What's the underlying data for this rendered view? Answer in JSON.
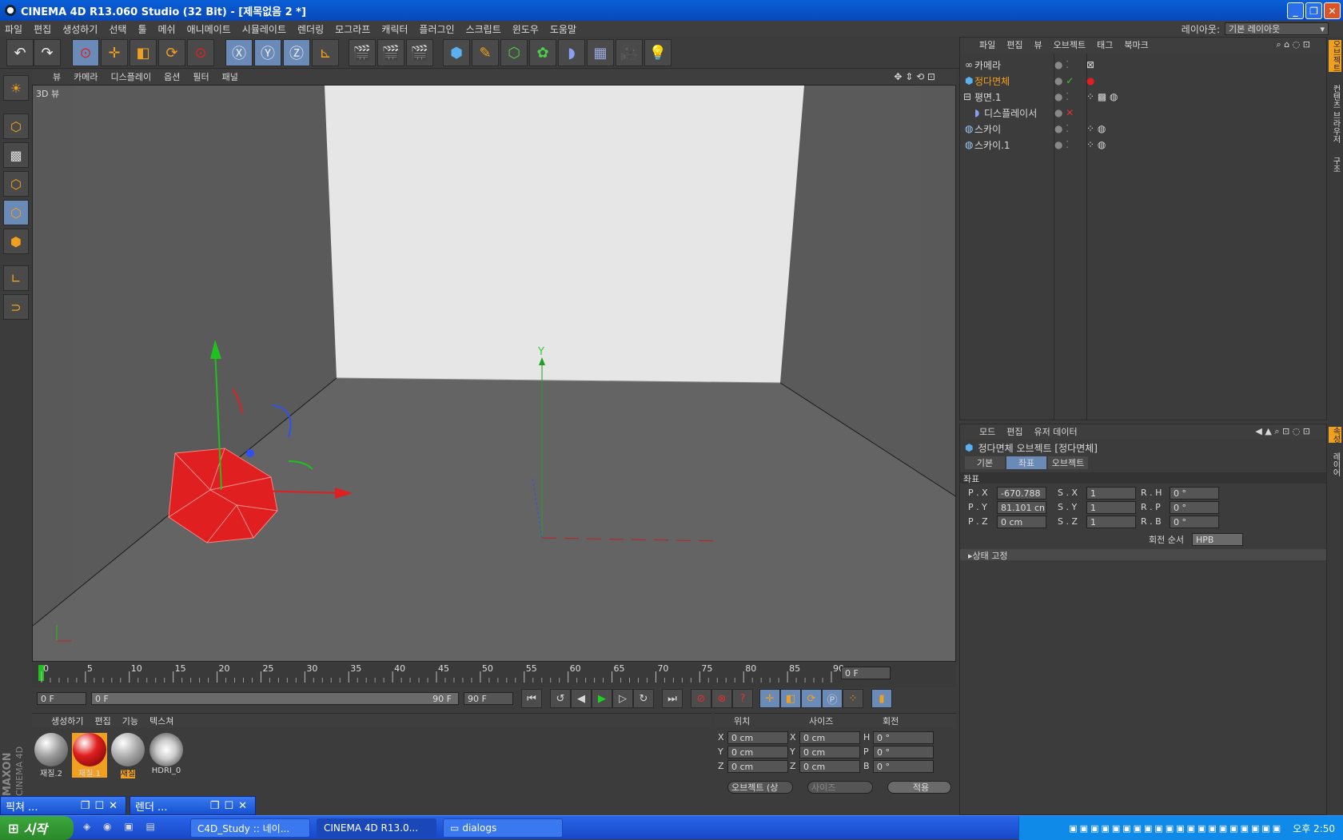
{
  "window": {
    "title": "CINEMA 4D R13.060 Studio (32 Bit) - [제목없음 2 *]",
    "min": "_",
    "max": "❐",
    "close": "✕"
  },
  "menu": [
    "파일",
    "편집",
    "생성하기",
    "선택",
    "툴",
    "메쉬",
    "애니메이트",
    "시뮬레이트",
    "렌더링",
    "모그라프",
    "캐릭터",
    "플러그인",
    "스크립트",
    "윈도우",
    "도움말"
  ],
  "layout": {
    "label": "레이아웃:",
    "value": "기본 레이아웃"
  },
  "viewport": {
    "menu": [
      "뷰",
      "카메라",
      "디스플레이",
      "옵션",
      "필터",
      "패널"
    ],
    "label": "3D 뷰",
    "axis_y": "Y"
  },
  "timeline": {
    "ticks": [
      "0",
      "5",
      "10",
      "15",
      "20",
      "25",
      "30",
      "35",
      "40",
      "45",
      "50",
      "55",
      "60",
      "65",
      "70",
      "75",
      "80",
      "85",
      "90"
    ],
    "current": "0 F"
  },
  "transport": {
    "start": "0 F",
    "range_start": "0 F",
    "range_end": "90 F",
    "end": "90 F"
  },
  "materials": {
    "menu": [
      "생성하기",
      "편집",
      "기능",
      "텍스쳐"
    ],
    "items": [
      "재질.2",
      "재질.1",
      "재질",
      "HDRI_0"
    ]
  },
  "coords": {
    "headers": [
      "위치",
      "사이즈",
      "회전"
    ],
    "rows": [
      [
        "X",
        "0 cm",
        "X",
        "0 cm",
        "H",
        "0 °"
      ],
      [
        "Y",
        "0 cm",
        "Y",
        "0 cm",
        "P",
        "0 °"
      ],
      [
        "Z",
        "0 cm",
        "Z",
        "0 cm",
        "B",
        "0 °"
      ]
    ],
    "mode": "오브젝트 (상",
    "size_mode": "사이즈",
    "apply": "적용"
  },
  "object_manager": {
    "menu": [
      "파일",
      "편집",
      "뷰",
      "오브젝트",
      "태그",
      "북마크"
    ],
    "objects": [
      {
        "name": "카메라"
      },
      {
        "name": "정다면체"
      },
      {
        "name": "평면.1"
      },
      {
        "name": "디스플레이서"
      },
      {
        "name": "스카이"
      },
      {
        "name": "스카이.1"
      }
    ]
  },
  "attributes": {
    "menu": [
      "모드",
      "편집",
      "유저 데이터"
    ],
    "title": "정다면체 오브젝트 [정다면체]",
    "tabs": [
      "기본",
      "좌표",
      "오브젝트"
    ],
    "section": "좌표",
    "fields": [
      [
        "P . X",
        "-670.788",
        "S . X",
        "1",
        "R . H",
        "0 °"
      ],
      [
        "P . Y",
        "81.101 cn",
        "S . Y",
        "1",
        "R . P",
        "0 °"
      ],
      [
        "P . Z",
        "0 cm",
        "S . Z",
        "1",
        "R . B",
        "0 °"
      ]
    ],
    "rot_order_label": "회전 순서",
    "rot_order": "HPB",
    "freeze": "상태 고정"
  },
  "side_tabs": [
    "오브젝트",
    "컨텐츠 브라우저",
    "구조"
  ],
  "side_tabs2": [
    "속성",
    "레이어"
  ],
  "brand": {
    "maxon": "MAXON",
    "c4d": "CINEMA 4D"
  },
  "task_windows": [
    {
      "label": "픽쳐 ..."
    },
    {
      "label": "렌더 ..."
    }
  ],
  "taskbar": {
    "start": "시작",
    "items": [
      "C4D_Study :: 네이...",
      "CINEMA 4D R13.0...",
      "dialogs"
    ],
    "clock": "오후 2:50"
  },
  "colors": {
    "accent": "#6a8ab8",
    "selected_object": "#f0a020",
    "titlebar": "#0a5fd8"
  }
}
